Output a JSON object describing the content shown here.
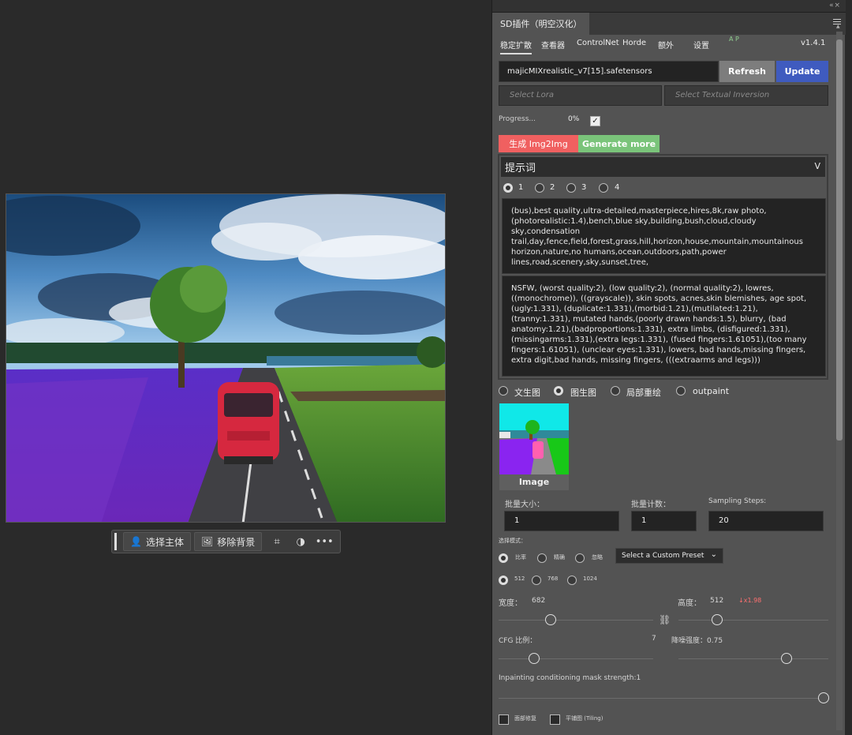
{
  "context_toolbar": {
    "select_subject": "选择主体",
    "remove_background": "移除背景"
  },
  "panel": {
    "tab_title": "SD插件（明空汉化）",
    "nav": [
      "稳定扩散",
      "查看器",
      "ControlNet",
      "Horde",
      "额外",
      "设置"
    ],
    "nav_extra": "A P",
    "version": "v1.4.1",
    "model": "majicMIXrealistic_v7[15].safetensors",
    "refresh_label": "Refresh",
    "update_label": "Update",
    "select_lora_placeholder": "Select Lora",
    "select_ti_placeholder": "Select Textual Inversion",
    "progress_label": "Progress...",
    "progress_value": "0%",
    "progress_checked": true,
    "generate_label": "生成 Img2Img",
    "generate_more_label": "Generate more",
    "prompt_title": "提示词",
    "prompt_tabs": [
      "1",
      "2",
      "3",
      "4"
    ],
    "positive_prompt": "(bus),best quality,ultra-detailed,masterpiece,hires,8k,raw photo,(photorealistic:1.4),bench,blue sky,building,bush,cloud,cloudy sky,condensation trail,day,fence,field,forest,grass,hill,horizon,house,mountain,mountainous horizon,nature,no humans,ocean,outdoors,path,power lines,road,scenery,sky,sunset,tree,",
    "negative_prompt": "NSFW, (worst quality:2), (low quality:2), (normal quality:2), lowres, ((monochrome)), ((grayscale)), skin spots, acnes,skin blemishes, age spot, (ugly:1.331), (duplicate:1.331),(morbid:1.21),(mutilated:1.21), (tranny:1.331), mutated hands,(poorly drawn hands:1.5), blurry, (bad anatomy:1.21),(badproportions:1.331), extra limbs, (disfigured:1.331), (missingarms:1.331),(extra legs:1.331), (fused fingers:1.61051),(too many fingers:1.61051), (unclear eyes:1.331), lowers, bad hands,missing fingers, extra digit,bad hands, missing fingers, (((extraarms and legs)))",
    "modes": [
      "文生图",
      "图生图",
      "局部重绘",
      "outpaint"
    ],
    "image_caption": "Image",
    "batch_size_label": "批量大小：",
    "batch_size": "1",
    "batch_count_label": "批量计数：",
    "batch_count": "1",
    "steps_label": "Sampling Steps:",
    "steps": "20",
    "select_mode_label": "选择模式：",
    "select_modes": [
      "比率",
      "精确",
      "忽略"
    ],
    "preset_label": "Select a Custom Preset",
    "sizes": [
      "512",
      "768",
      "1024"
    ],
    "width_label": "宽度：",
    "width_value": "682",
    "height_label": "高度：",
    "height_value": "512",
    "scale_note": "↓x1.98",
    "cfg_label": "CFG 比例：",
    "cfg_value": "7",
    "denoise_label": "降噪强度：0.75",
    "mask_label": "Inpainting conditioning mask strength:1",
    "face_fix_label": "面部修复",
    "tiling_label": "平铺图 (Tiling)"
  },
  "colors": {
    "refresh_bg": "#7d7d7d",
    "update_bg": "#3f5bbf",
    "generate_bg": "#f06060",
    "generate_more_bg": "#7ac47a",
    "scale_note": "#ff7070"
  }
}
